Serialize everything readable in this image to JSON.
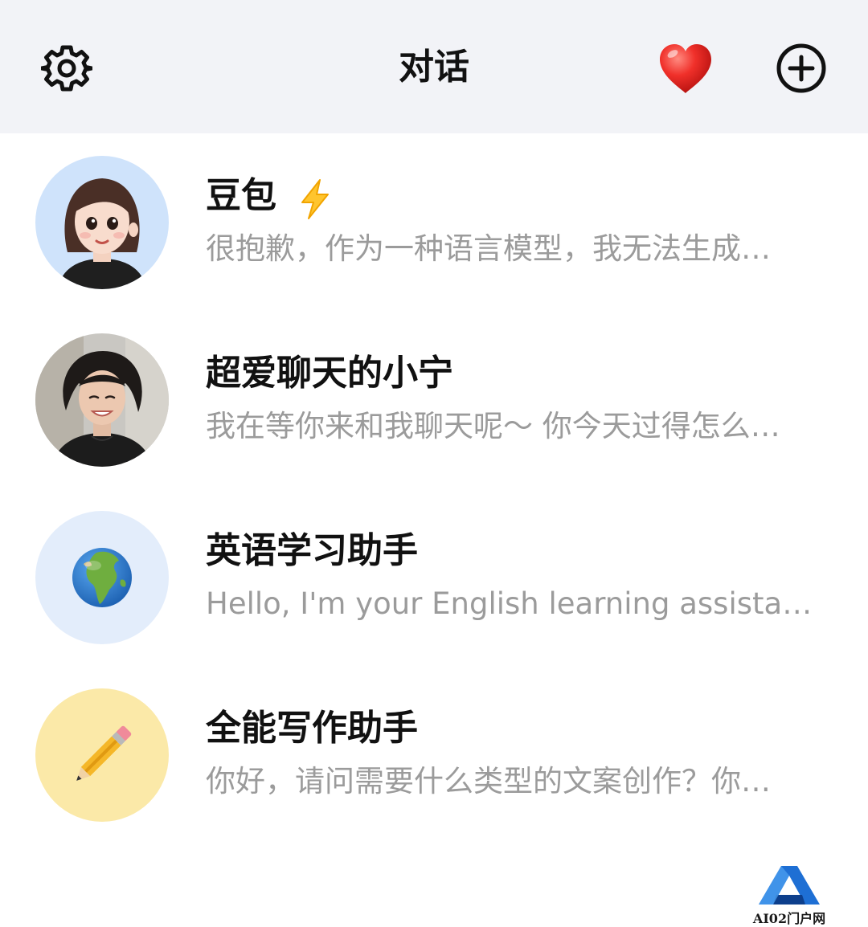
{
  "header": {
    "title": "对话",
    "icons": [
      "gear-icon",
      "heart-icon",
      "plus-circle-icon"
    ]
  },
  "conversations": [
    {
      "name": "豆包",
      "preview": "很抱歉，作为一种语言模型，我无法生成…",
      "badge_icon": "lightning-icon",
      "avatar": "cartoon-girl-avatar"
    },
    {
      "name": "超爱聊天的小宁",
      "preview": "我在等你来和我聊天呢～ 你今天过得怎么…",
      "avatar": "photo-girl-avatar"
    },
    {
      "name": "英语学习助手",
      "preview": "Hello, I'm your English learning assistant....",
      "avatar": "globe-icon"
    },
    {
      "name": "全能写作助手",
      "preview": "你好，请问需要什么类型的文案创作？你…",
      "avatar": "pencil-icon"
    }
  ],
  "watermark": {
    "text": "AI02门户网"
  },
  "colors": {
    "header_bg": "#f2f3f7",
    "name_text": "#111111",
    "preview_text": "#9b9b9b",
    "avatar_globe_bg": "#e3edfb",
    "avatar_pencil_bg": "#fbe9a8"
  }
}
